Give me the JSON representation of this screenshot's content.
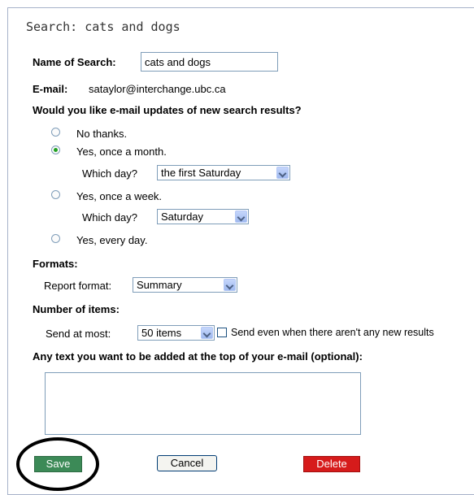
{
  "title": "Search: cats and dogs",
  "name_of_search": {
    "label": "Name of Search:",
    "value": "cats and dogs"
  },
  "email": {
    "label": "E-mail:",
    "value": "sataylor@interchange.ubc.ca"
  },
  "updates_question": "Would you like e-mail updates of new search results?",
  "options": {
    "no_thanks": "No thanks.",
    "monthly": "Yes, once a month.",
    "weekly": "Yes, once a week.",
    "daily": "Yes, every day.",
    "selected": "monthly"
  },
  "which_day_label": "Which day?",
  "monthly_day": "the first Saturday",
  "weekly_day": "Saturday",
  "formats": {
    "heading": "Formats:",
    "report_label": "Report format:",
    "report_value": "Summary"
  },
  "items": {
    "heading": "Number of items:",
    "send_label": "Send at most:",
    "send_value": "50 items",
    "send_even_label": "Send even when there aren't any new results",
    "send_even_checked": false
  },
  "text_heading": "Any text you want to be added at the top of your e-mail (optional):",
  "text_value": "",
  "buttons": {
    "save": "Save",
    "cancel": "Cancel",
    "delete": "Delete"
  }
}
